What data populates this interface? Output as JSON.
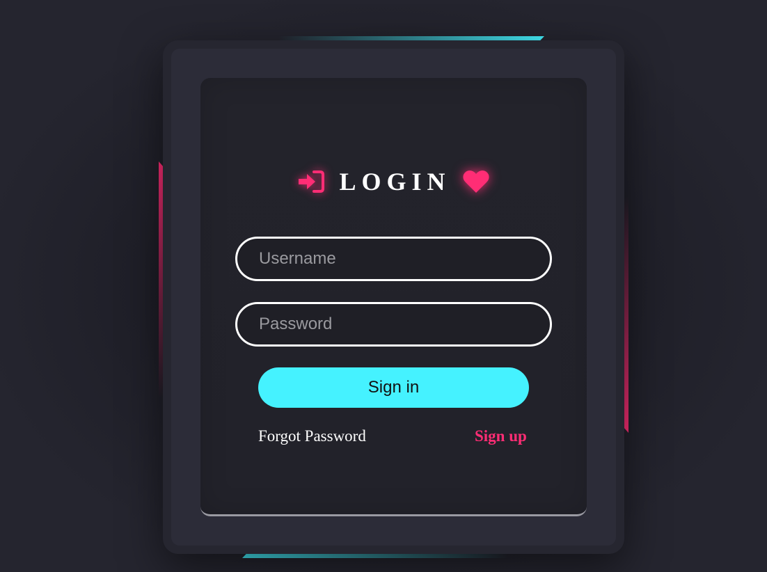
{
  "title": "LOGIN",
  "icons": {
    "login": "sign-in-icon",
    "heart": "heart-icon"
  },
  "form": {
    "username_placeholder": "Username",
    "password_placeholder": "Password",
    "username_value": "",
    "password_value": ""
  },
  "actions": {
    "signin_label": "Sign in",
    "forgot_label": "Forgot Password",
    "signup_label": "Sign up"
  },
  "colors": {
    "accent_cyan": "#45f2ff",
    "accent_pink": "#ff2d75",
    "background": "#25252f",
    "card": "#23232b"
  }
}
